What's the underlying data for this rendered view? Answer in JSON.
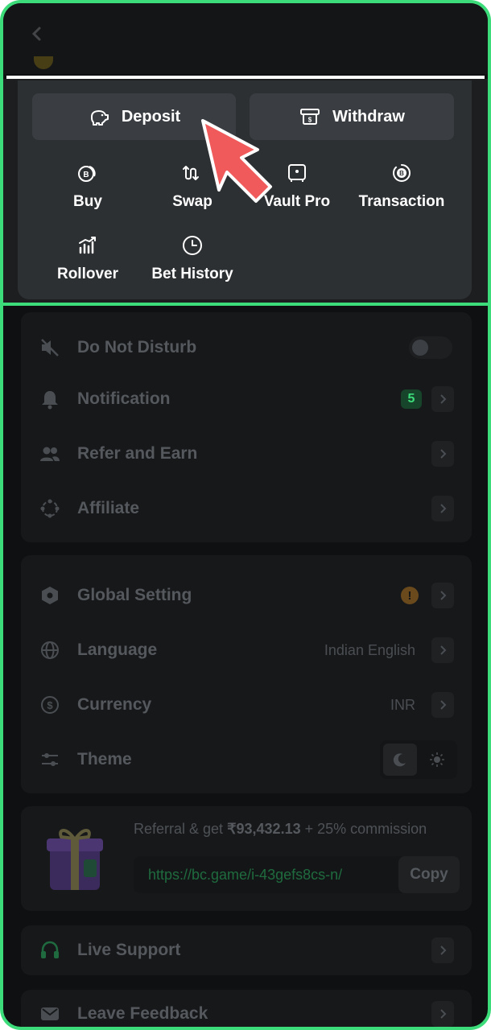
{
  "wallet": {
    "deposit_label": "Deposit",
    "withdraw_label": "Withdraw",
    "actions": [
      {
        "label": "Buy",
        "icon": "bitcoin-coin-icon"
      },
      {
        "label": "Swap",
        "icon": "swap-arrows-icon"
      },
      {
        "label": "Vault Pro",
        "icon": "vault-icon"
      },
      {
        "label": "Transaction",
        "icon": "transaction-icon"
      },
      {
        "label": "Rollover",
        "icon": "rollover-chart-icon"
      },
      {
        "label": "Bet History",
        "icon": "clock-icon"
      }
    ]
  },
  "menu1": {
    "do_not_disturb": "Do Not Disturb",
    "notification": "Notification",
    "notification_count": "5",
    "refer": "Refer and Earn",
    "affiliate": "Affiliate"
  },
  "menu2": {
    "global_setting": "Global Setting",
    "global_setting_badge": "!",
    "language": "Language",
    "language_value": "Indian English",
    "currency": "Currency",
    "currency_value": "INR",
    "theme": "Theme"
  },
  "referral": {
    "text_prefix": "Referral & get ",
    "amount": "₹93,432.13",
    "text_suffix": " + 25% commission",
    "link": "https://bc.game/i-43gefs8cs-n/",
    "copy_label": "Copy"
  },
  "support": {
    "live_support": "Live Support",
    "leave_feedback": "Leave Feedback"
  },
  "colors": {
    "accent_green": "#3ddc7a",
    "cursor_red": "#f05a5a",
    "warning_orange": "#e08a1e"
  }
}
